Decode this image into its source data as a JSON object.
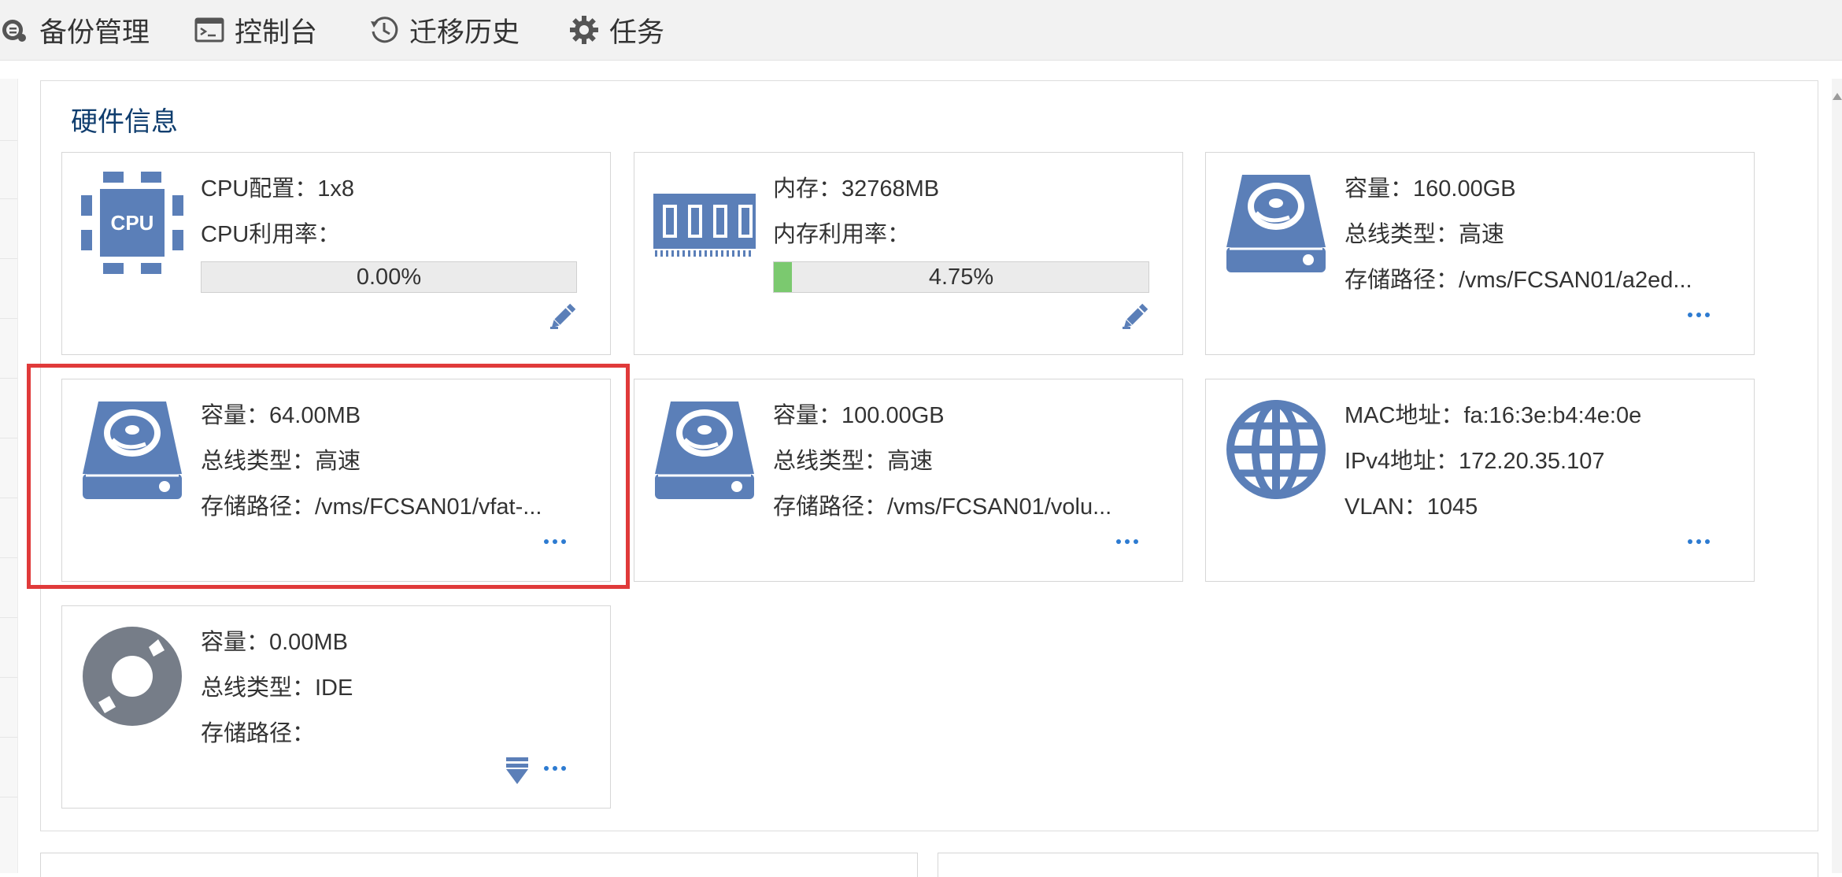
{
  "toolbar": {
    "tabs": [
      {
        "label": "备份管理",
        "icon": "backup-icon"
      },
      {
        "label": "控制台",
        "icon": "console-icon"
      },
      {
        "label": "迁移历史",
        "icon": "history-icon"
      },
      {
        "label": "任务",
        "icon": "gear-icon"
      }
    ]
  },
  "hardware": {
    "title": "硬件信息",
    "cpu": {
      "config": "CPU配置：1x8",
      "usage_label": "CPU利用率：",
      "usage_pct": "0.00%",
      "usage_value": 0.0,
      "icon_text": "CPU"
    },
    "memory": {
      "size": "内存：32768MB",
      "usage_label": "内存利用率：",
      "usage_pct": "4.75%",
      "usage_value": 4.75
    },
    "disk1": {
      "capacity": "容量：160.00GB",
      "bus": "总线类型：高速",
      "path": "存储路径：/vms/FCSAN01/a2ed..."
    },
    "disk2": {
      "capacity": "容量：64.00MB",
      "bus": "总线类型：高速",
      "path": "存储路径：/vms/FCSAN01/vfat-..."
    },
    "disk3": {
      "capacity": "容量：100.00GB",
      "bus": "总线类型：高速",
      "path": "存储路径：/vms/FCSAN01/volu..."
    },
    "nic": {
      "mac": "MAC地址：fa:16:3e:b4:4e:0e",
      "ipv4": "IPv4地址：172.20.35.107",
      "vlan": "VLAN：1045"
    },
    "cdrom": {
      "capacity": "容量：0.00MB",
      "bus": "总线类型：IDE",
      "path": "存储路径："
    }
  },
  "colors": {
    "icon_blue": "#5b7fb8",
    "icon_grey": "#767d88",
    "progress_fill": "#7bc96f",
    "highlight": "#e03a3a",
    "link": "#2d7bd1"
  }
}
